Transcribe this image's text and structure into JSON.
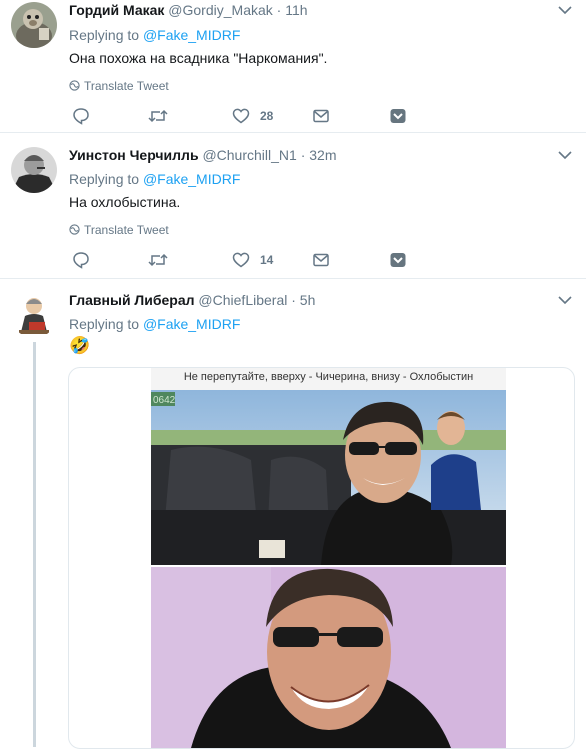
{
  "tweets": [
    {
      "name": "Гордий Макак",
      "handle": "@Gordiy_Makak",
      "time": "11h",
      "replying_prefix": "Replying to ",
      "replying_to": "@Fake_MIDRF",
      "text": "Она похожа на всадника \"Наркомания\".",
      "translate": "Translate Tweet",
      "likes": "28"
    },
    {
      "name": "Уинстон Черчилль",
      "handle": "@Churchill_N1",
      "time": "32m",
      "replying_prefix": "Replying to ",
      "replying_to": "@Fake_MIDRF",
      "text": "На охлобыстина.",
      "translate": "Translate Tweet",
      "likes": "14"
    },
    {
      "name": "Главный Либерал",
      "handle": "@ChiefLiberal",
      "time": "5h",
      "replying_prefix": "Replying to ",
      "replying_to": "@Fake_MIDRF",
      "text": "🤣",
      "media_caption": "Не перепутайте, вверху - Чичерина, внизу - Охлобыстин",
      "media_watermark": "0642"
    }
  ],
  "dot": "·",
  "icons": [
    "chevron-down-icon",
    "globe-icon",
    "reply-icon",
    "retweet-icon",
    "heart-icon",
    "envelope-icon",
    "bookmark-icon"
  ],
  "colors": {
    "link": "#1da1f2",
    "secondary": "#657786",
    "border": "#e6ecf0",
    "thread": "#ccd6dd"
  }
}
